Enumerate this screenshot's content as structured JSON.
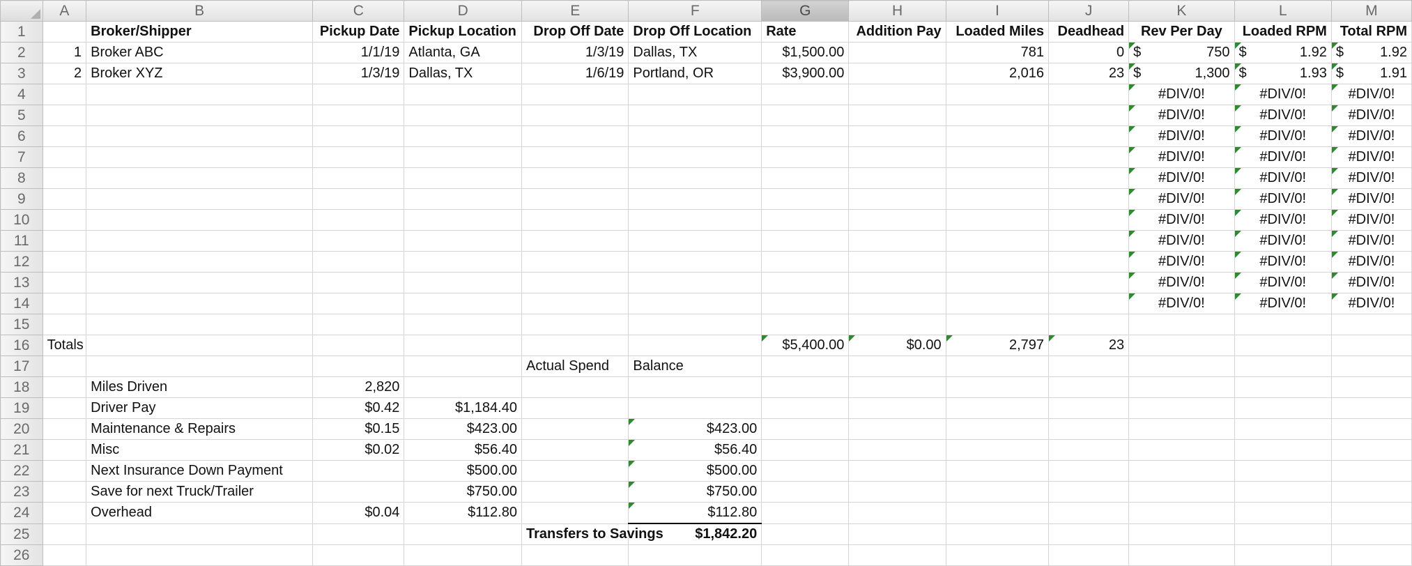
{
  "columns": [
    "A",
    "B",
    "C",
    "D",
    "E",
    "F",
    "G",
    "H",
    "I",
    "J",
    "K",
    "L",
    "M"
  ],
  "selected_column": "G",
  "row_numbers": [
    "1",
    "2",
    "3",
    "4",
    "5",
    "6",
    "7",
    "8",
    "9",
    "10",
    "11",
    "12",
    "13",
    "14",
    "15",
    "16",
    "17",
    "18",
    "19",
    "20",
    "21",
    "22",
    "23",
    "24",
    "25",
    "26"
  ],
  "headers": {
    "broker": "Broker/Shipper",
    "pickup_date": "Pickup Date",
    "pickup_location": "Pickup Location",
    "drop_date": "Drop Off Date",
    "drop_location": "Drop Off Location",
    "rate": "Rate",
    "addition_pay": "Addition Pay",
    "loaded_miles": "Loaded Miles",
    "deadhead": "Deadhead",
    "rev_per_day": "Rev Per Day",
    "loaded_rpm": "Loaded RPM",
    "total_rpm": "Total RPM"
  },
  "loads": [
    {
      "num": "1",
      "broker": "Broker ABC",
      "pickup_date": "1/1/19",
      "pickup_location": "Atlanta, GA",
      "drop_date": "1/3/19",
      "drop_location": "Dallas, TX",
      "rate": "$1,500.00",
      "loaded_miles": "781",
      "deadhead": "0",
      "rev_per_day": "750",
      "loaded_rpm": "1.92",
      "total_rpm": "1.92"
    },
    {
      "num": "2",
      "broker": "Broker XYZ",
      "pickup_date": "1/3/19",
      "pickup_location": "Dallas, TX",
      "drop_date": "1/6/19",
      "drop_location": "Portland, OR",
      "rate": "$3,900.00",
      "loaded_miles": "2,016",
      "deadhead": "23",
      "rev_per_day": "1,300",
      "loaded_rpm": "1.93",
      "total_rpm": "1.91"
    }
  ],
  "currency_symbol": "$",
  "error_value": "#DIV/0!",
  "totals": {
    "label": "Totals",
    "rate": "$5,400.00",
    "addition_pay": "$0.00",
    "loaded_miles": "2,797",
    "deadhead": "23"
  },
  "budget": {
    "actual_spend_label": "Actual Spend",
    "balance_label": "Balance",
    "miles_driven": {
      "label": "Miles Driven",
      "value": "2,820"
    },
    "items": [
      {
        "label": "Driver Pay",
        "rate": "$0.42",
        "amount": "$1,184.40",
        "balance": ""
      },
      {
        "label": "Maintenance & Repairs",
        "rate": "$0.15",
        "amount": "$423.00",
        "balance": "$423.00"
      },
      {
        "label": "Misc",
        "rate": "$0.02",
        "amount": "$56.40",
        "balance": "$56.40"
      },
      {
        "label": "Next Insurance Down Payment",
        "rate": "",
        "amount": "$500.00",
        "balance": "$500.00"
      },
      {
        "label": "Save for next Truck/Trailer",
        "rate": "",
        "amount": "$750.00",
        "balance": "$750.00"
      },
      {
        "label": "Overhead",
        "rate": "$0.04",
        "amount": "$112.80",
        "balance": "$112.80"
      }
    ],
    "transfers_label": "Transfers to Savings",
    "transfers_value": "$1,842.20"
  }
}
